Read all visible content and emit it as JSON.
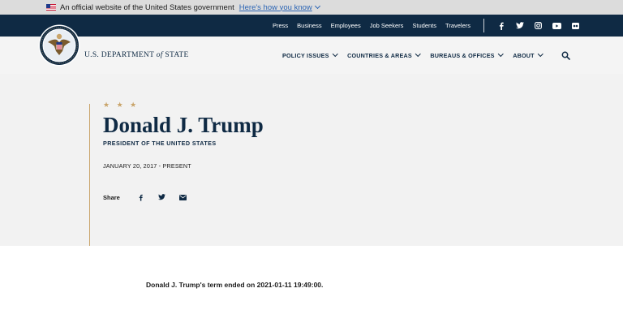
{
  "gov_banner": {
    "text": "An official website of the United States government",
    "link": "Here's how you know",
    "flag_icon": "us-flag-icon"
  },
  "top_bar": {
    "links": [
      "Press",
      "Business",
      "Employees",
      "Job Seekers",
      "Students",
      "Travelers"
    ],
    "social": [
      "facebook-icon",
      "twitter-icon",
      "instagram-icon",
      "youtube-icon",
      "flickr-icon"
    ]
  },
  "header": {
    "brand": "U.S. DEPARTMENT",
    "brand_of": "of",
    "brand_state": "STATE",
    "nav": [
      "POLICY ISSUES",
      "COUNTRIES & AREAS",
      "BUREAUS & OFFICES",
      "ABOUT"
    ],
    "search_icon": "search-icon"
  },
  "hero": {
    "stars": "★ ★ ★",
    "name": "Donald J. Trump",
    "role": "PRESIDENT OF THE UNITED STATES",
    "dates": "JANUARY 20, 2017 - PRESENT",
    "share_label": "Share",
    "share_icons": [
      "facebook-icon",
      "twitter-icon",
      "email-icon"
    ]
  },
  "body": {
    "term_note": "Donald J. Trump's term ended on 2021-01-11 19:49:00."
  },
  "colors": {
    "navy": "#0f2a44",
    "gold": "#c9a46a",
    "banner_gray": "#dcdcdc",
    "hero_bg": "#f2f2f2",
    "link_blue": "#2a64b4"
  }
}
